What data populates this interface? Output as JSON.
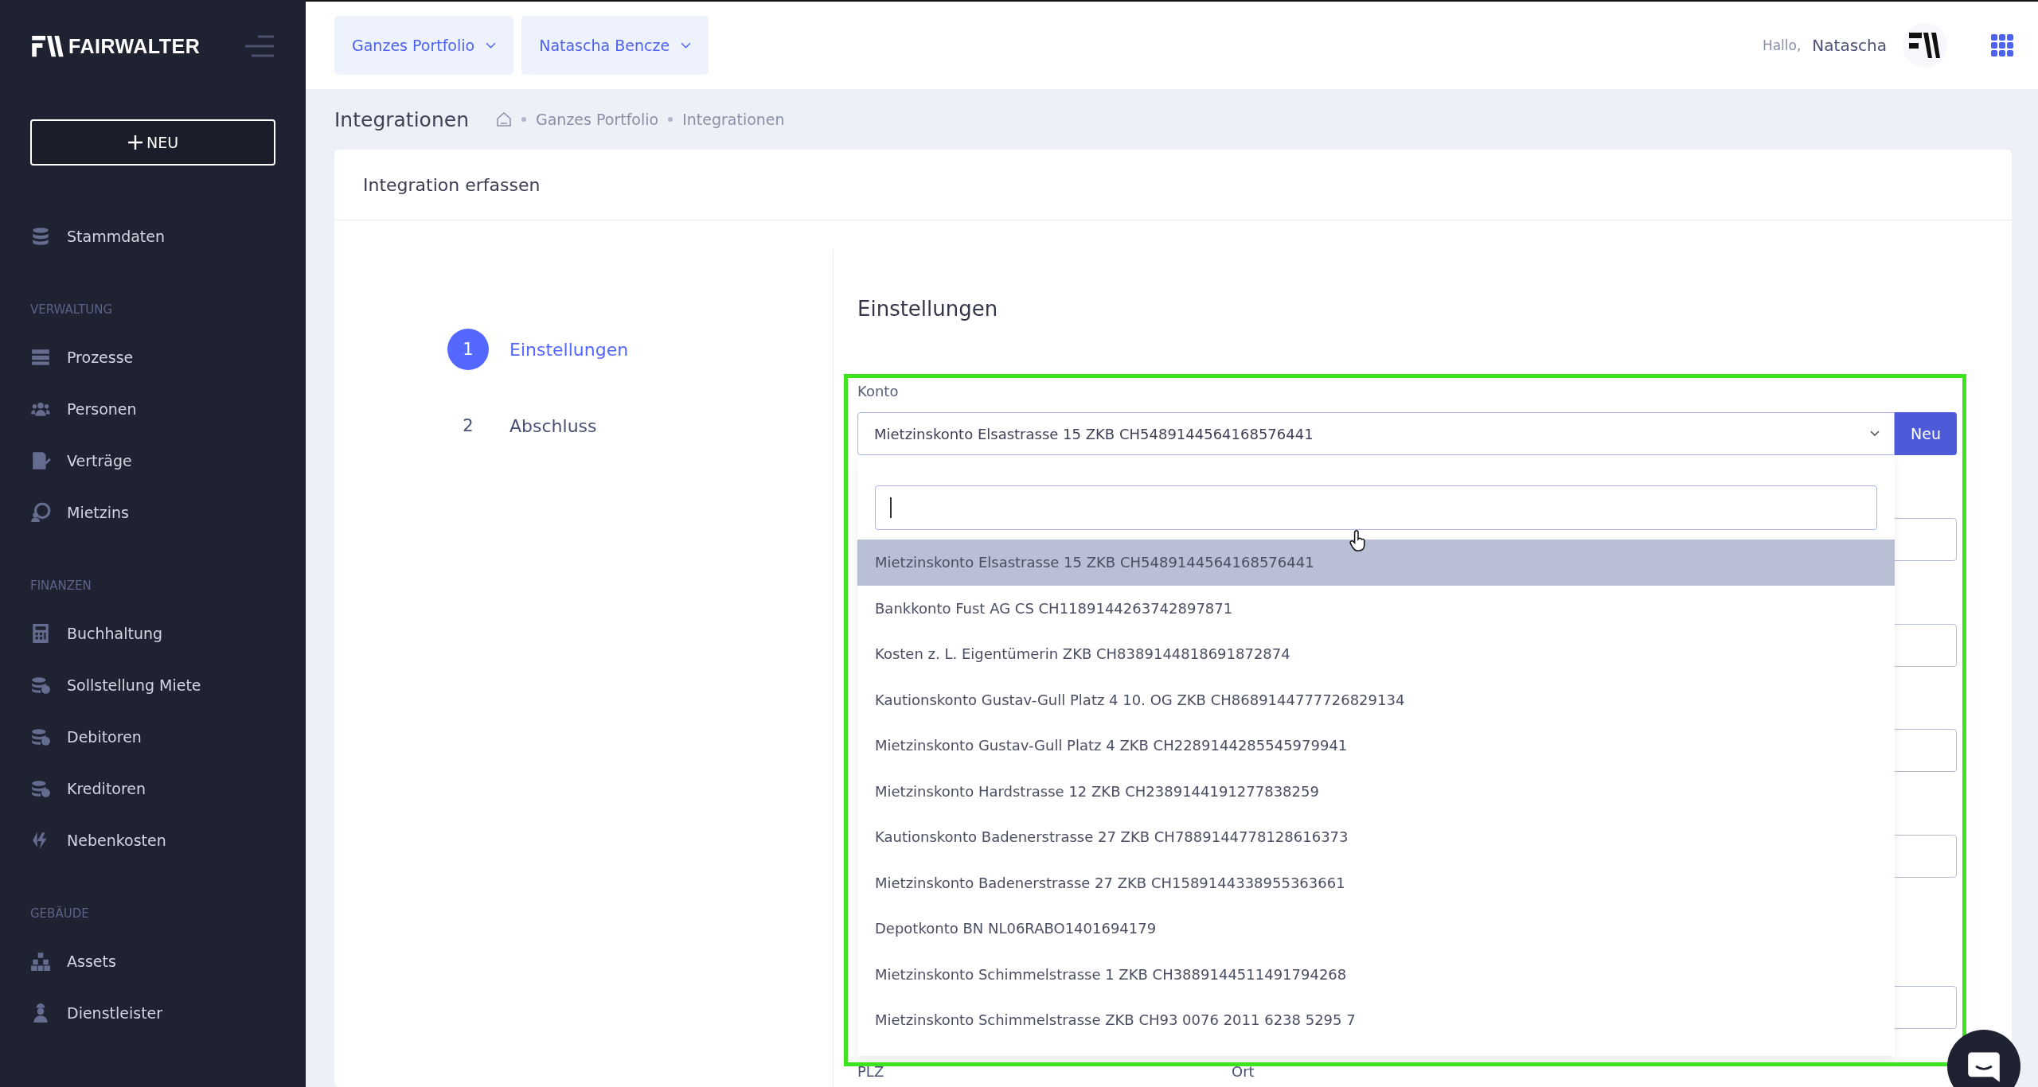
{
  "sidebar": {
    "brand": "FAIRWALTER",
    "new_button": "NEU",
    "sections": [
      {
        "items": [
          {
            "label": "Stammdaten"
          }
        ]
      },
      {
        "heading": "VERWALTUNG",
        "items": [
          {
            "label": "Prozesse"
          },
          {
            "label": "Personen"
          },
          {
            "label": "Verträge"
          },
          {
            "label": "Mietzins"
          }
        ]
      },
      {
        "heading": "FINANZEN",
        "items": [
          {
            "label": "Buchhaltung"
          },
          {
            "label": "Sollstellung Miete"
          },
          {
            "label": "Debitoren"
          },
          {
            "label": "Kreditoren"
          },
          {
            "label": "Nebenkosten"
          }
        ]
      },
      {
        "heading": "GEBÄUDE",
        "items": [
          {
            "label": "Assets"
          },
          {
            "label": "Dienstleister"
          }
        ]
      }
    ]
  },
  "topbar": {
    "filters": [
      "Ganzes Portfolio",
      "Natascha Bencze"
    ],
    "greeting": "Hallo,",
    "user": "Natascha"
  },
  "page": {
    "title": "Integrationen",
    "breadcrumb": [
      "Ganzes Portfolio",
      "Integrationen"
    ]
  },
  "card": {
    "title": "Integration erfassen",
    "steps": [
      {
        "number": "1",
        "label": "Einstellungen",
        "selected": true
      },
      {
        "number": "2",
        "label": "Abschluss",
        "selected": false
      }
    ],
    "section_title": "Einstellungen",
    "konto": {
      "label": "Konto",
      "value": "Mietzinskonto Elsastrasse 15 ZKB CH5489144564168576441",
      "button": "Neu",
      "options": [
        {
          "label": "Mietzinskonto Elsastrasse 15 ZKB CH5489144564168576441",
          "selected": true
        },
        {
          "label": "Bankkonto Fust AG CS CH1189144263742897871",
          "selected": false
        },
        {
          "label": "Kosten z. L. Eigentümerin ZKB CH8389144818691872874",
          "selected": false
        },
        {
          "label": "Kautionskonto Gustav-Gull Platz 4 10. OG ZKB CH8689144777726829134",
          "selected": false
        },
        {
          "label": "Mietzinskonto Gustav-Gull Platz 4 ZKB CH2289144285545979941",
          "selected": false
        },
        {
          "label": "Mietzinskonto Hardstrasse 12 ZKB CH2389144191277838259",
          "selected": false
        },
        {
          "label": "Kautionskonto Badenerstrasse 27 ZKB CH7889144778128616373",
          "selected": false
        },
        {
          "label": "Mietzinskonto Badenerstrasse 27 ZKB CH1589144338955363661",
          "selected": false
        },
        {
          "label": "Depotkonto BN NL06RABO1401694179",
          "selected": false
        },
        {
          "label": "Mietzinskonto Schimmelstrasse 1 ZKB CH3889144511491794268",
          "selected": false
        },
        {
          "label": "Mietzinskonto Schimmelstrasse ZKB CH93 0076 2011 6238 5295 7",
          "selected": false
        }
      ]
    },
    "bottom_labels": [
      "PLZ",
      "Ort"
    ]
  }
}
